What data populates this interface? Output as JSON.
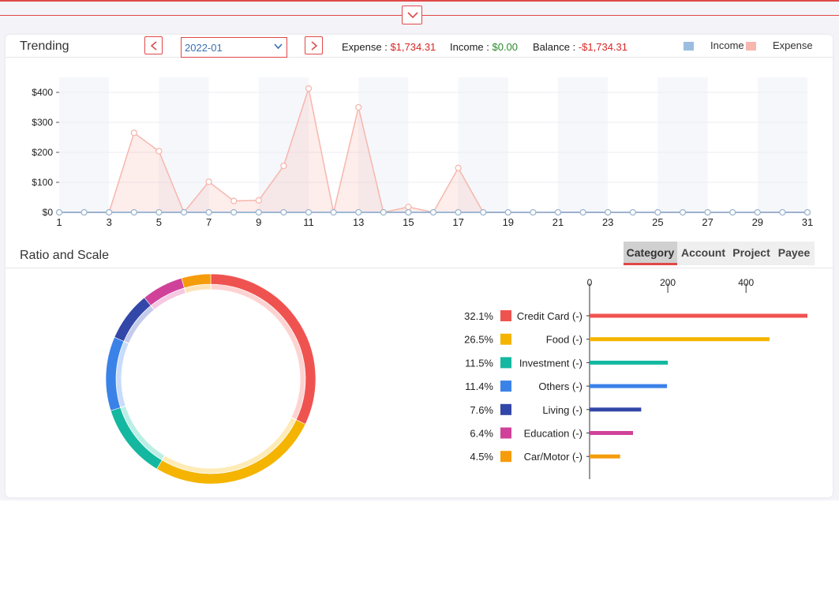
{
  "trending": {
    "title": "Trending",
    "month": "2022-01",
    "expense_label": "Expense :",
    "expense_value": "$1,734.31",
    "income_label": "Income :",
    "income_value": "$0.00",
    "balance_label": "Balance :",
    "balance_value": "-$1,734.31",
    "legend": [
      {
        "label": "Income",
        "color": "#9cbde0"
      },
      {
        "label": "Expense",
        "color": "#f6b7ae"
      }
    ]
  },
  "ratio": {
    "title": "Ratio and Scale",
    "tabs": [
      "Category",
      "Account",
      "Project",
      "Payee"
    ],
    "active_tab": "Category"
  },
  "chart_data": [
    {
      "type": "area",
      "x": [
        1,
        2,
        3,
        4,
        5,
        6,
        7,
        8,
        9,
        10,
        11,
        12,
        13,
        14,
        15,
        16,
        17,
        18,
        19,
        20,
        21,
        22,
        23,
        24,
        25,
        26,
        27,
        28,
        29,
        30,
        31
      ],
      "x_tick_labels": [
        "1",
        "3",
        "5",
        "7",
        "9",
        "11",
        "13",
        "15",
        "17",
        "19",
        "21",
        "23",
        "25",
        "27",
        "29",
        "31"
      ],
      "y_tick_labels": [
        "$0",
        "$100",
        "$200",
        "$300",
        "$400"
      ],
      "ylim": [
        0,
        450
      ],
      "series": [
        {
          "name": "Income",
          "color": "#9cbde0",
          "values": [
            0,
            0,
            0,
            0,
            0,
            0,
            0,
            0,
            0,
            0,
            0,
            0,
            0,
            0,
            0,
            0,
            0,
            0,
            0,
            0,
            0,
            0,
            0,
            0,
            0,
            0,
            0,
            0,
            0,
            0,
            0
          ]
        },
        {
          "name": "Expense",
          "color": "#f6b7ae",
          "values": [
            0,
            0,
            0,
            265,
            204,
            0,
            102,
            38,
            40,
            155,
            413,
            0,
            350,
            0,
            18,
            0,
            148,
            0,
            0,
            0,
            0,
            0,
            0,
            0,
            0,
            0,
            0,
            0,
            0,
            0,
            0
          ]
        }
      ],
      "grid": true
    },
    {
      "type": "pie",
      "variant": "donut",
      "slices": [
        {
          "label": "Credit Card (-)",
          "percent": 32.1,
          "color": "#ef5350",
          "light": "#fdd3d2"
        },
        {
          "label": "Food (-)",
          "percent": 26.5,
          "color": "#f4b400",
          "light": "#fdebb8"
        },
        {
          "label": "Investment (-)",
          "percent": 11.5,
          "color": "#14b8a0",
          "light": "#bdeee6"
        },
        {
          "label": "Others (-)",
          "percent": 11.4,
          "color": "#3b82e8",
          "light": "#c8dcf9"
        },
        {
          "label": "Living (-)",
          "percent": 7.6,
          "color": "#3347a8",
          "light": "#c5cbea"
        },
        {
          "label": "Education (-)",
          "percent": 6.4,
          "color": "#d0429a",
          "light": "#f5c8e3"
        },
        {
          "label": "Car/Motor (-)",
          "percent": 4.5,
          "color": "#f59c0b",
          "light": "#fde3b8"
        }
      ]
    },
    {
      "type": "bar",
      "orientation": "horizontal",
      "categories": [
        "Credit Card (-)",
        "Food (-)",
        "Investment (-)",
        "Others (-)",
        "Living (-)",
        "Education (-)",
        "Car/Motor (-)"
      ],
      "percent_labels": [
        "32.1%",
        "26.5%",
        "11.5%",
        "11.4%",
        "7.6%",
        "6.4%",
        "4.5%"
      ],
      "values": [
        557,
        460,
        200,
        198,
        132,
        111,
        78
      ],
      "x_tick_labels": [
        "0",
        "200",
        "400"
      ],
      "xlim": [
        0,
        557
      ]
    }
  ]
}
